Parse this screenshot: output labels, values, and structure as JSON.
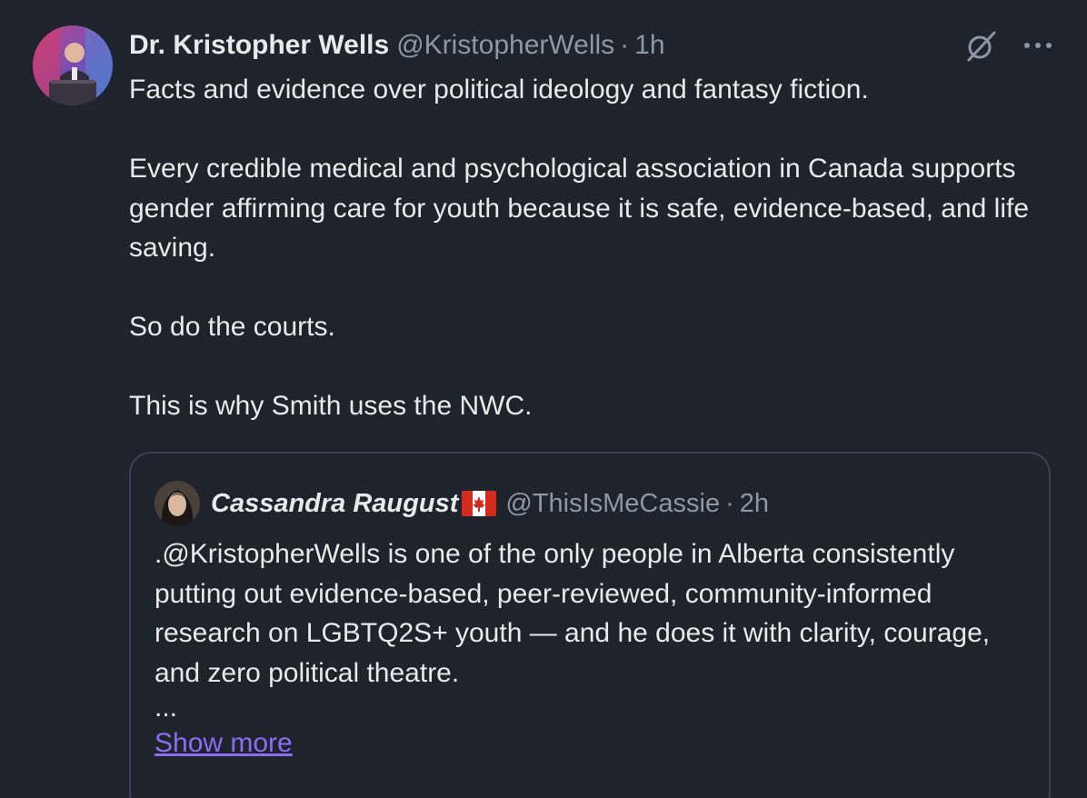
{
  "tweet": {
    "author_name": "Dr. Kristopher Wells",
    "author_handle": "@KristopherWells",
    "separator": "·",
    "time": "1h",
    "paragraphs": [
      "Facts and evidence over political ideology and fantasy fiction.",
      "Every credible medical and psychological association in Canada supports gender affirming care for youth because it is safe, evidence-based, and life saving.",
      "So do the courts.",
      "This is why Smith uses the NWC."
    ],
    "icons": {
      "grok": "slashed-circle-icon",
      "more": "more-horizontal-icon"
    }
  },
  "quote": {
    "author_name": "Cassandra Raugust",
    "flag": "canada-flag-icon",
    "author_handle": "@ThisIsMeCassie",
    "separator": "·",
    "time": "2h",
    "text": ".@KristopherWells is one of the only people in Alberta consistently putting out evidence-based, peer-reviewed, community-informed research on LGBTQ2S+ youth — and he does it with clarity, courage, and zero political theatre.",
    "ellipsis": "...",
    "show_more": "Show more"
  },
  "colors": {
    "background": "#1e232c",
    "text_primary": "#e7e9ea",
    "text_secondary": "#8b98a5",
    "link": "#8b6cf2",
    "card_border": "#3a4150"
  }
}
